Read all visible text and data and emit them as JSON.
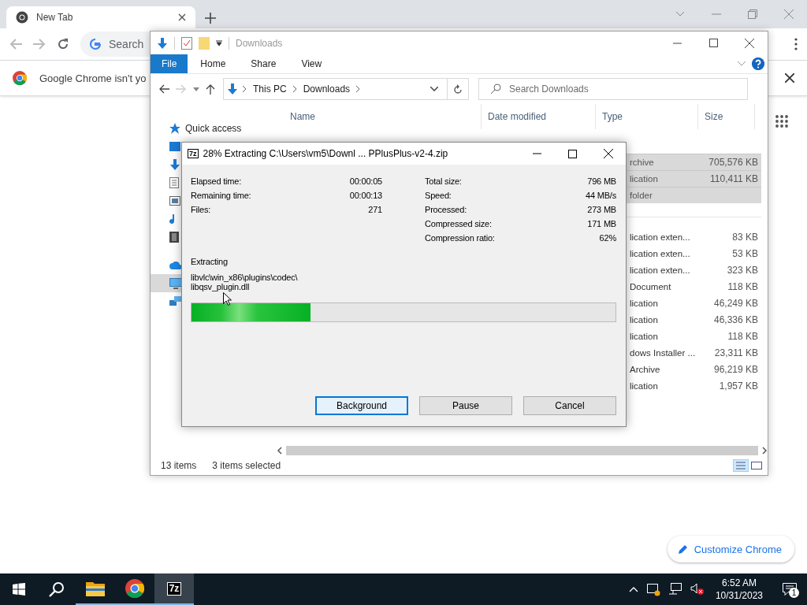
{
  "browser": {
    "tabs": [
      {
        "title": "New Tab",
        "selected": true
      }
    ],
    "omnibox": {
      "placeholder": "Search"
    },
    "infobar": {
      "text": "Google Chrome isn't yo"
    },
    "customize_button": "Customize Chrome"
  },
  "explorer": {
    "title": "Downloads",
    "ribbon_tabs": [
      {
        "label": "File",
        "selected": true
      },
      {
        "label": "Home",
        "selected": false
      },
      {
        "label": "Share",
        "selected": false
      },
      {
        "label": "View",
        "selected": false
      }
    ],
    "breadcrumb": [
      "This PC",
      "Downloads"
    ],
    "search": {
      "placeholder": "Search Downloads"
    },
    "columns": [
      "Name",
      "Date modified",
      "Type",
      "Size"
    ],
    "quick_access": "Quick access",
    "nav_items": [
      {
        "kind": "desktop",
        "selected": false
      },
      {
        "kind": "downloads",
        "selected": false
      },
      {
        "kind": "documents",
        "selected": false
      },
      {
        "kind": "pictures",
        "selected": false
      },
      {
        "kind": "music",
        "selected": false
      },
      {
        "kind": "videos",
        "selected": false
      },
      {
        "kind": "onedrive",
        "selected": false
      },
      {
        "kind": "this-pc",
        "selected": true
      },
      {
        "kind": "network",
        "selected": false
      }
    ],
    "groups": [
      {
        "rows": [
          {
            "type": "rchive",
            "size": "705,576 KB",
            "selected": true
          },
          {
            "type": "lication",
            "size": "110,411 KB",
            "selected": true
          },
          {
            "type": "folder",
            "selected": true
          }
        ]
      },
      {
        "rows": [
          {
            "type": "lication exten...",
            "size": "83 KB",
            "selected": false
          },
          {
            "type": "lication exten...",
            "size": "53 KB",
            "selected": false
          },
          {
            "type": "lication exten...",
            "size": "323 KB",
            "selected": false
          },
          {
            "type": "Document",
            "size": "118 KB",
            "selected": false
          },
          {
            "type": "lication",
            "size": "46,249 KB",
            "selected": false
          },
          {
            "type": "lication",
            "size": "46,336 KB",
            "selected": false
          },
          {
            "type": "lication",
            "size": "118 KB",
            "selected": false
          },
          {
            "type": "dows Installer ...",
            "size": "23,311 KB",
            "selected": false
          },
          {
            "type": "Archive",
            "size": "96,219 KB",
            "selected": false
          },
          {
            "type": "lication",
            "size": "1,957 KB",
            "selected": false
          }
        ]
      }
    ],
    "status": {
      "count": "13 items",
      "selection": "3 items selected"
    }
  },
  "extract_dialog": {
    "icon_label": "7z",
    "title": "28% Extracting C:\\Users\\vm5\\Downl ... PPlusPlus-v2-4.zip",
    "stats_left": [
      {
        "label": "Elapsed time:",
        "value": "00:00:05"
      },
      {
        "label": "Remaining time:",
        "value": "00:00:13"
      },
      {
        "label": "Files:",
        "value": "271"
      }
    ],
    "stats_right": [
      {
        "label": "Total size:",
        "value": "796 MB"
      },
      {
        "label": "Speed:",
        "value": "44 MB/s"
      },
      {
        "label": "Processed:",
        "value": "273 MB"
      },
      {
        "label": "Compressed size:",
        "value": "171 MB"
      },
      {
        "label": "Compression ratio:",
        "value": "62%"
      }
    ],
    "status_label": "Extracting",
    "current_file_lines": [
      "libvlc\\win_x86\\plugins\\codec\\",
      "libqsv_plugin.dll"
    ],
    "progress": {
      "level": 0.28
    },
    "buttons": [
      {
        "label": "Background",
        "focused": true
      },
      {
        "label": "Pause",
        "focused": false
      },
      {
        "label": "Cancel",
        "focused": false
      }
    ]
  },
  "taskbar": {
    "apps": [
      {
        "kind": "file-explorer",
        "running": true,
        "active": false
      },
      {
        "kind": "chrome",
        "running": true,
        "active": false
      },
      {
        "kind": "archiver",
        "label": "7z",
        "running": true,
        "active": true
      }
    ],
    "clock": {
      "time": "6:52 AM",
      "date": "10/31/2023"
    },
    "notifications": "1"
  }
}
